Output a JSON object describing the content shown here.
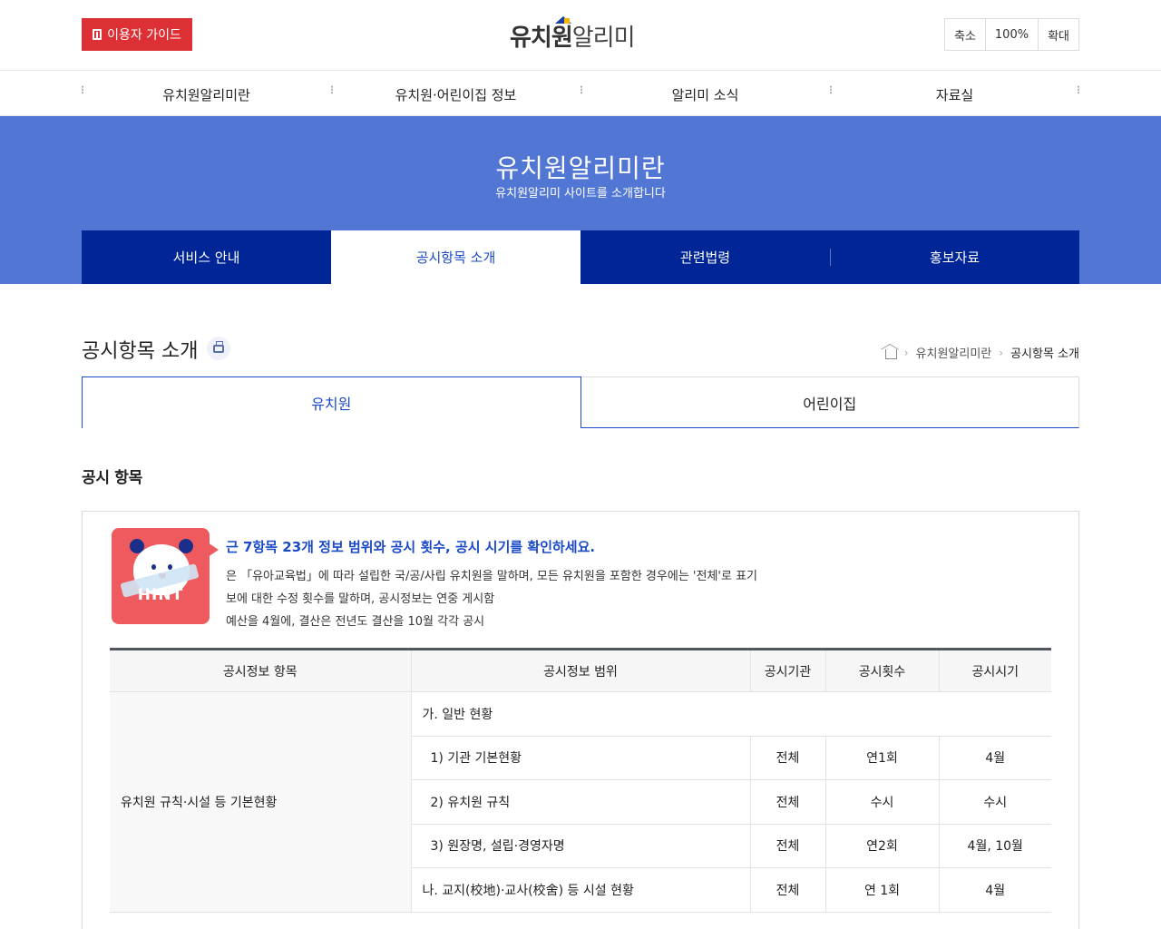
{
  "header": {
    "guide_button": "이용자 가이드",
    "logo_bold": "유치원",
    "logo_light": "알리미",
    "zoom_out": "축소",
    "zoom_level": "100%",
    "zoom_in": "확대"
  },
  "gnb": [
    "유치원알리미란",
    "유치원·어린이집 정보",
    "알리미 소식",
    "자료실"
  ],
  "visual": {
    "title": "유치원알리미란",
    "subtitle": "유치원알리미 사이트를 소개합니다"
  },
  "subnav": [
    {
      "label": "서비스 안내",
      "active": false
    },
    {
      "label": "공시항목 소개",
      "active": true
    },
    {
      "label": "관련법령",
      "active": false
    },
    {
      "label": "홍보자료",
      "active": false
    }
  ],
  "page": {
    "title": "공시항목 소개",
    "breadcrumb": [
      "유치원알리미란",
      "공시항목 소개"
    ]
  },
  "inst_tabs": [
    "유치원",
    "어린이집"
  ],
  "section": {
    "title": "공시 항목",
    "lead": "근 7항목 23개 정보 범위와 공시 횟수, 공시 시기를 확인하세요.",
    "notes": [
      "은 「유아교육법」에 따라 설립한 국/공/사립 유치원을 말하며, 모든 유치원을 포함한 경우에는 '전체'로 표기",
      "보에 대한 수정 횟수를 말하며, 공시정보는 연중 게시함",
      "예산을 4월에, 결산은 전년도 결산을 10월 각각 공시"
    ],
    "hint_label": "HINT"
  },
  "table": {
    "headers": [
      "공시정보 항목",
      "공시정보 범위",
      "공시기관",
      "공시횟수",
      "공시시기"
    ],
    "category": "유치원 규칙·시설 등 기본현황",
    "group_a": "가. 일반 현황",
    "rows": [
      {
        "scope": "1) 기관 기본현황",
        "org": "전체",
        "count": "연1회",
        "when": "4월"
      },
      {
        "scope": "2) 유치원 규칙",
        "org": "전체",
        "count": "수시",
        "when": "수시"
      },
      {
        "scope": "3) 원장명, 설립·경영자명",
        "org": "전체",
        "count": "연2회",
        "when": "4월, 10월"
      }
    ],
    "group_b": {
      "scope": "나. 교지(校地)·교사(校舍) 등 시설 현황",
      "org": "전체",
      "count": "연 1회",
      "when": "4월"
    }
  }
}
